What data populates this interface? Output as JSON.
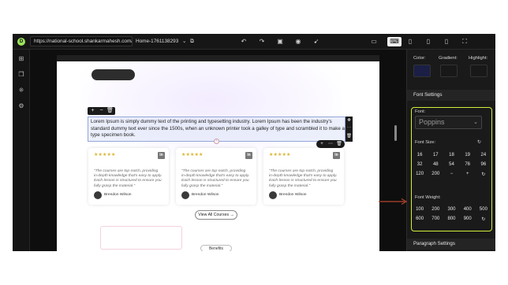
{
  "topbar": {
    "url": "https://national-school.shankarmahesh.com/",
    "page_name": "Home-1761138293",
    "page_caret": "⌄",
    "copy_icon": "⧉",
    "actions": [
      {
        "name": "undo-icon",
        "glyph": "↶"
      },
      {
        "name": "redo-icon",
        "glyph": "↷"
      },
      {
        "name": "save-icon",
        "glyph": "▣"
      },
      {
        "name": "preview-eye-icon",
        "glyph": "◉"
      },
      {
        "name": "publish-rocket-icon",
        "glyph": "➹"
      }
    ],
    "devices": [
      {
        "name": "desktop-device-icon",
        "glyph": "▭"
      },
      {
        "name": "laptop-device-icon",
        "glyph": "⌨"
      },
      {
        "name": "tablet-landscape-device-icon",
        "glyph": "▯"
      },
      {
        "name": "tablet-device-icon",
        "glyph": "▯"
      },
      {
        "name": "mobile-device-icon",
        "glyph": "▯"
      },
      {
        "name": "fullscreen-icon",
        "glyph": "⛶"
      }
    ]
  },
  "leftrail": [
    {
      "name": "add-element-icon",
      "glyph": "⊞"
    },
    {
      "name": "layers-icon",
      "glyph": "❐"
    },
    {
      "name": "components-icon",
      "glyph": "⁜"
    },
    {
      "name": "settings-gear-icon",
      "glyph": "⚙"
    }
  ],
  "canvas": {
    "element_toolbar": [
      "+",
      "−",
      "🗑"
    ],
    "paragraph": "Lorem Ipsum is simply dummy text of the printing and typesetting industry. Lorem Ipsum has been the industry's standard dummy text ever since the 1500s, when an unknown printer took a galley of type and scrambled it to make a type specimen book.",
    "side_toolbar": [
      "✥",
      "⋯",
      "🗑"
    ],
    "card_toolbar": [
      "+",
      "⋯",
      "🗑"
    ],
    "cards": [
      {
        "stars": "★★★★★",
        "quote": "“The courses are top-notch, providing in-depth knowledge that's easy to apply. Each lesson is structured to ensure you fully grasp the material.”",
        "author": "Brendon Wilson",
        "social": "in"
      },
      {
        "stars": "★★★★★",
        "quote": "“The courses are top-notch, providing in-depth knowledge that's easy to apply. Each lesson is structured to ensure you fully grasp the material.”",
        "author": "Brendon Wilson",
        "social": "in"
      },
      {
        "stars": "★★★★★",
        "quote": "“The courses are top-notch, providing in-depth knowledge that's easy to apply. Each lesson is structured to ensure you fully grasp the material.”",
        "author": "Brendon Wilson",
        "social": "in"
      }
    ],
    "view_all": "View All Courses →",
    "benefits": "Benefits"
  },
  "panel": {
    "color_label": "Color:",
    "gradient_label": "Gradient:",
    "highlight_label": "Highlight:",
    "font_settings": "Font Settings",
    "font_label": "Font:",
    "font_value": "Poppins",
    "font_caret": "⌄",
    "font_size_label": "Font Size:",
    "font_size_reset": "↻",
    "font_sizes": [
      "16",
      "17",
      "18",
      "19",
      "24",
      "32",
      "48",
      "54",
      "76",
      "96",
      "120",
      "200",
      "−",
      "+",
      "↻"
    ],
    "font_weight_label": "Font Weight:",
    "font_weights": [
      "100",
      "200",
      "300",
      "400",
      "500",
      "600",
      "700",
      "800",
      "900",
      "↻"
    ],
    "paragraph_settings": "Paragraph Settings"
  },
  "colors": {
    "accent_border": "#d4ef3a",
    "arrow": "#b5452e",
    "stars": "#d9b531"
  }
}
